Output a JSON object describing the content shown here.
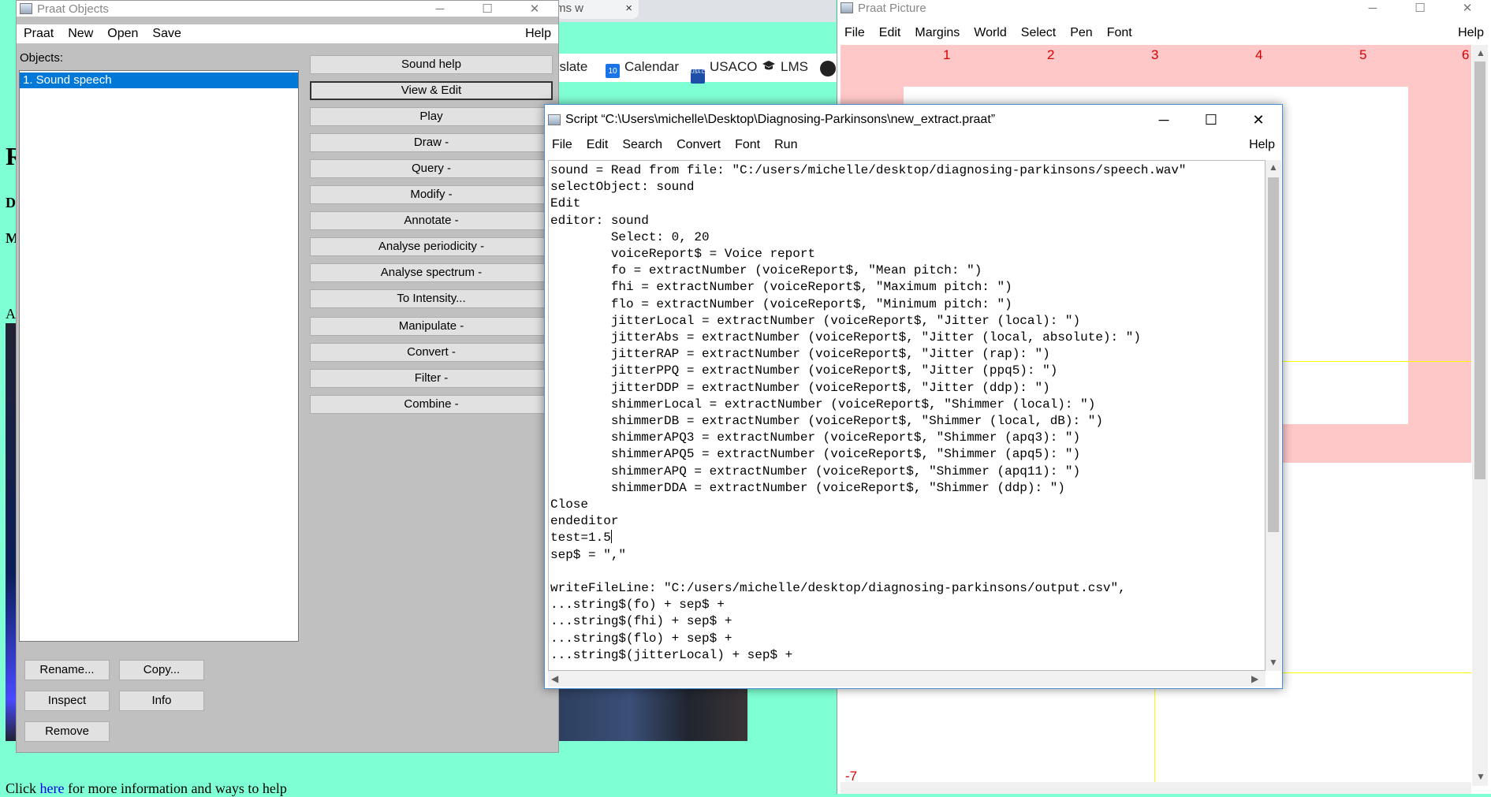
{
  "background_page": {
    "tab_label": "ms w",
    "tab_close": "×",
    "bookmarks": [
      {
        "label": "nslate",
        "icon": ""
      },
      {
        "label": "Calendar",
        "icon": "10"
      },
      {
        "label": "USACO",
        "icon": "USA CO"
      },
      {
        "label": "LMS",
        "icon": ""
      }
    ],
    "side_letters": [
      "R",
      "D",
      "M",
      "A"
    ],
    "footer_prefix": "Click ",
    "footer_link": "here",
    "footer_suffix": " for more information and ways to help"
  },
  "objects_window": {
    "title": "Praat Objects",
    "menu": [
      "Praat",
      "New",
      "Open",
      "Save"
    ],
    "help": "Help",
    "objects_label": "Objects:",
    "selected_object": "1. Sound speech",
    "actions": [
      "Sound help",
      "View & Edit",
      "Play",
      "Draw -",
      "Query -",
      "Modify -",
      "Annotate -",
      "Analyse periodicity -",
      "Analyse spectrum -",
      "To Intensity...",
      "Manipulate -",
      "Convert -",
      "Filter -",
      "Combine -"
    ],
    "bottom_buttons": {
      "rename": "Rename...",
      "copy": "Copy...",
      "inspect": "Inspect",
      "info": "Info",
      "remove": "Remove"
    }
  },
  "picture_window": {
    "title": "Praat Picture",
    "menu": [
      "File",
      "Edit",
      "Margins",
      "World",
      "Select",
      "Pen",
      "Font"
    ],
    "help": "Help",
    "ruler_labels": [
      "1",
      "2",
      "3",
      "4",
      "5",
      "6"
    ],
    "bottom_label": "-7"
  },
  "script_window": {
    "title": "Script “C:\\Users\\michelle\\Desktop\\Diagnosing-Parkinsons\\new_extract.praat”",
    "menu": [
      "File",
      "Edit",
      "Search",
      "Convert",
      "Font",
      "Run"
    ],
    "help": "Help",
    "code_before_caret": "sound = Read from file: \"C:/users/michelle/desktop/diagnosing-parkinsons/speech.wav\"\nselectObject: sound\nEdit\neditor: sound\n        Select: 0, 20\n        voiceReport$ = Voice report\n        fo = extractNumber (voiceReport$, \"Mean pitch: \")\n        fhi = extractNumber (voiceReport$, \"Maximum pitch: \")\n        flo = extractNumber (voiceReport$, \"Minimum pitch: \")\n        jitterLocal = extractNumber (voiceReport$, \"Jitter (local): \")\n        jitterAbs = extractNumber (voiceReport$, \"Jitter (local, absolute): \")\n        jitterRAP = extractNumber (voiceReport$, \"Jitter (rap): \")\n        jitterPPQ = extractNumber (voiceReport$, \"Jitter (ppq5): \")\n        jitterDDP = extractNumber (voiceReport$, \"Jitter (ddp): \")\n        shimmerLocal = extractNumber (voiceReport$, \"Shimmer (local): \")\n        shimmerDB = extractNumber (voiceReport$, \"Shimmer (local, dB): \")\n        shimmerAPQ3 = extractNumber (voiceReport$, \"Shimmer (apq3): \")\n        shimmerAPQ5 = extractNumber (voiceReport$, \"Shimmer (apq5): \")\n        shimmerAPQ = extractNumber (voiceReport$, \"Shimmer (apq11): \")\n        shimmerDDA = extractNumber (voiceReport$, \"Shimmer (ddp): \")\nClose\nendeditor\ntest=1.5",
    "code_after_caret": "\nsep$ = \",\"\n\nwriteFileLine: \"C:/users/michelle/desktop/diagnosing-parkinsons/output.csv\",\n...string$(fo) + sep$ +\n...string$(fhi) + sep$ +\n...string$(flo) + sep$ +\n...string$(jitterLocal) + sep$ +"
  },
  "window_controls": {
    "minimize": "─",
    "maximize": "☐",
    "close": "✕"
  },
  "colors": {
    "page_bg": "#7fffd4",
    "selection": "#0078d7",
    "picture_pink": "#ffc8c8",
    "ruler": "#dd0000"
  }
}
